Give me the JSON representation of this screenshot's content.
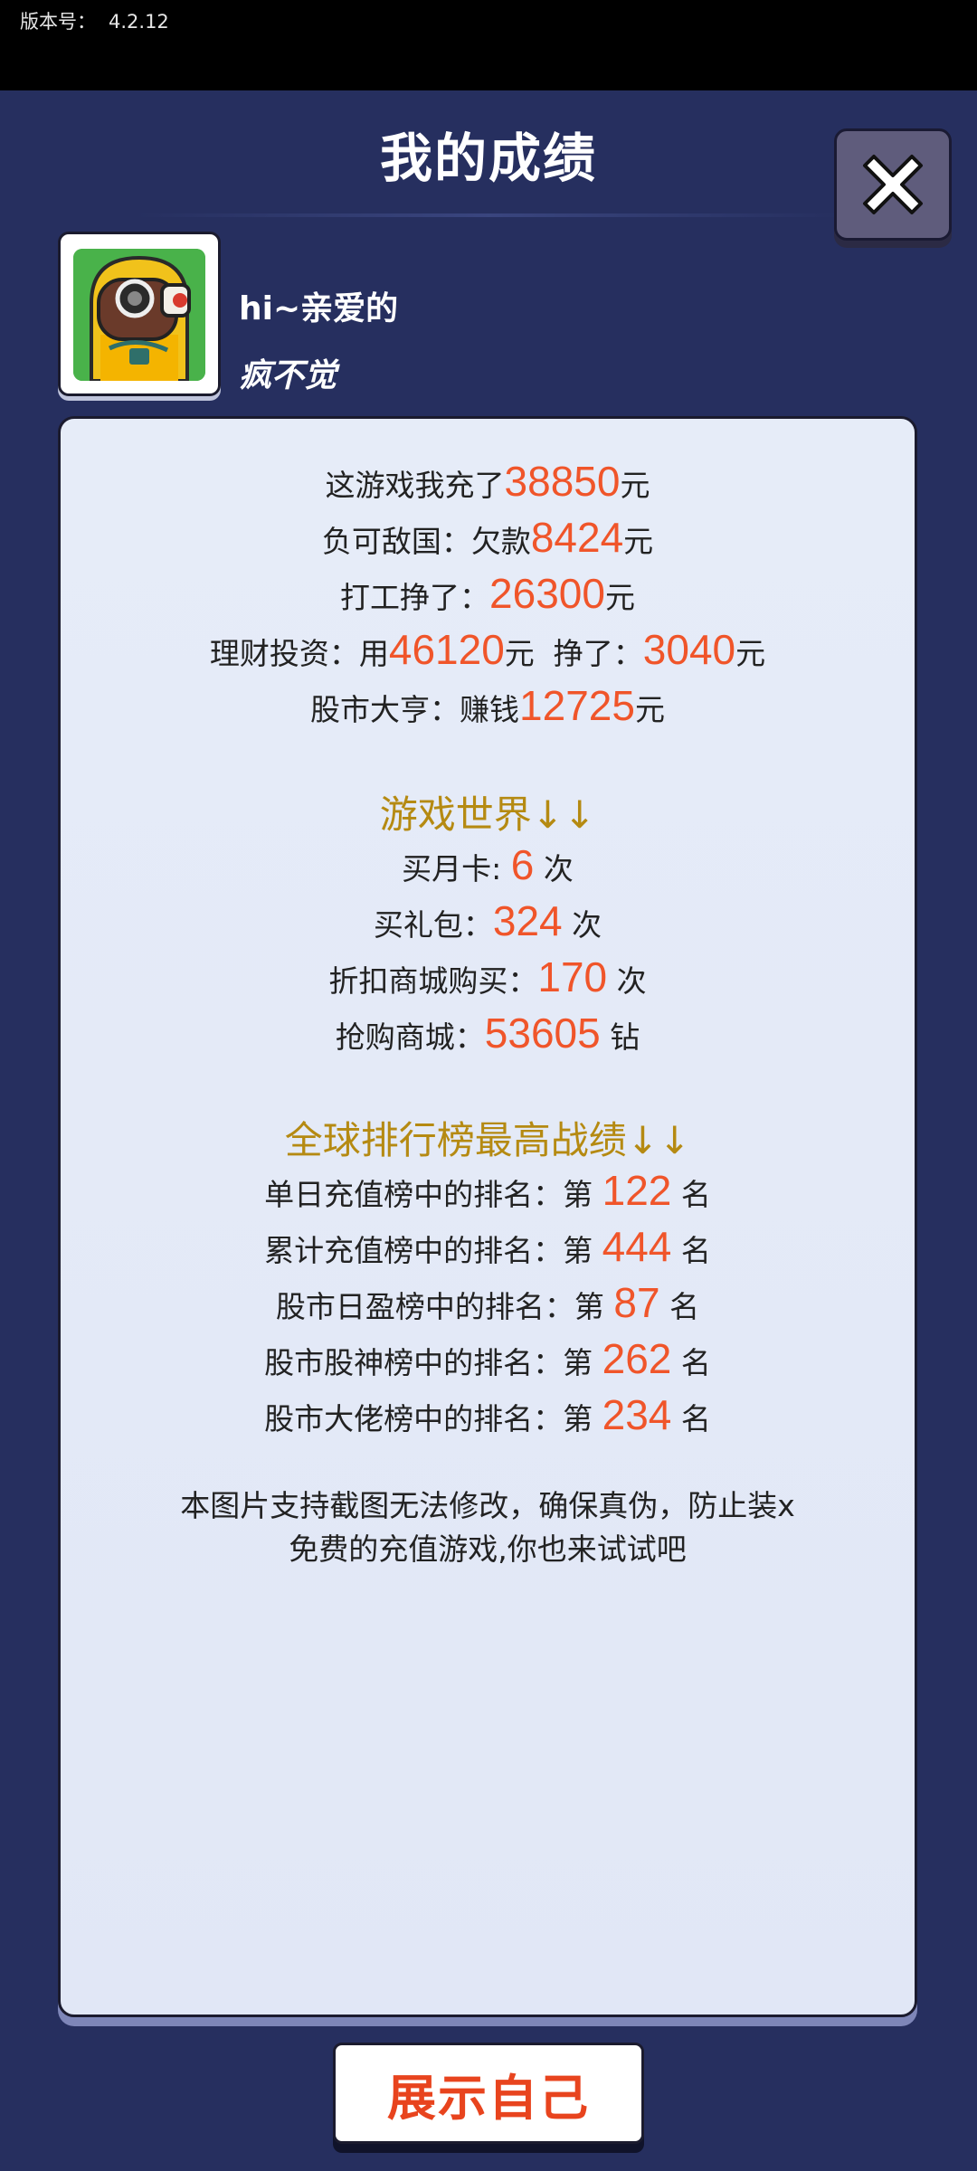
{
  "version": {
    "label": "版本号：",
    "value": "4.2.12"
  },
  "header": {
    "title": "我的成绩"
  },
  "profile": {
    "greeting": "hi~亲爱的",
    "name": "疯不觉"
  },
  "stats": {
    "recharge": {
      "prefix": "这游戏我充了",
      "value": "38850",
      "suffix": "元"
    },
    "debt": {
      "prefix": "负可敌国：欠款",
      "value": "8424",
      "suffix": "元"
    },
    "work": {
      "prefix": "打工挣了：",
      "value": "26300",
      "suffix": "元"
    },
    "invest": {
      "prefix": "理财投资：用",
      "spent": "46120",
      "mid": "元  挣了：",
      "earned": "3040",
      "suffix": "元"
    },
    "stock": {
      "prefix": "股市大亨：赚钱",
      "value": "12725",
      "suffix": "元"
    }
  },
  "game_world": {
    "title": "游戏世界↓↓",
    "items": [
      {
        "prefix": "买月卡: ",
        "value": "6",
        "suffix": " 次"
      },
      {
        "prefix": "买礼包：",
        "value": "324",
        "suffix": " 次"
      },
      {
        "prefix": "折扣商城购买：",
        "value": "170",
        "suffix": " 次"
      },
      {
        "prefix": "抢购商城：",
        "value": "53605",
        "suffix": " 钻"
      }
    ]
  },
  "ranking": {
    "title": "全球排行榜最高战绩↓↓",
    "items": [
      {
        "prefix": "单日充值榜中的排名：第 ",
        "value": "122",
        "suffix": " 名"
      },
      {
        "prefix": "累计充值榜中的排名：第 ",
        "value": "444",
        "suffix": " 名"
      },
      {
        "prefix": "股市日盈榜中的排名：第 ",
        "value": "87",
        "suffix": " 名"
      },
      {
        "prefix": "股市股神榜中的排名：第 ",
        "value": "262",
        "suffix": " 名"
      },
      {
        "prefix": "股市大佬榜中的排名：第 ",
        "value": "234",
        "suffix": " 名"
      }
    ]
  },
  "disclaimer": {
    "line1": "本图片支持截图无法修改，确保真伪，防止装x",
    "line2": "免费的充值游戏,你也来试试吧"
  },
  "actions": {
    "show_label": "展示自己"
  },
  "icons": {
    "close": "close-icon",
    "avatar": "gas-mask-character-avatar"
  },
  "colors": {
    "background": "#262f5f",
    "number": "#f0552a",
    "section_title": "#b58a12",
    "button_text": "#e8441e"
  }
}
